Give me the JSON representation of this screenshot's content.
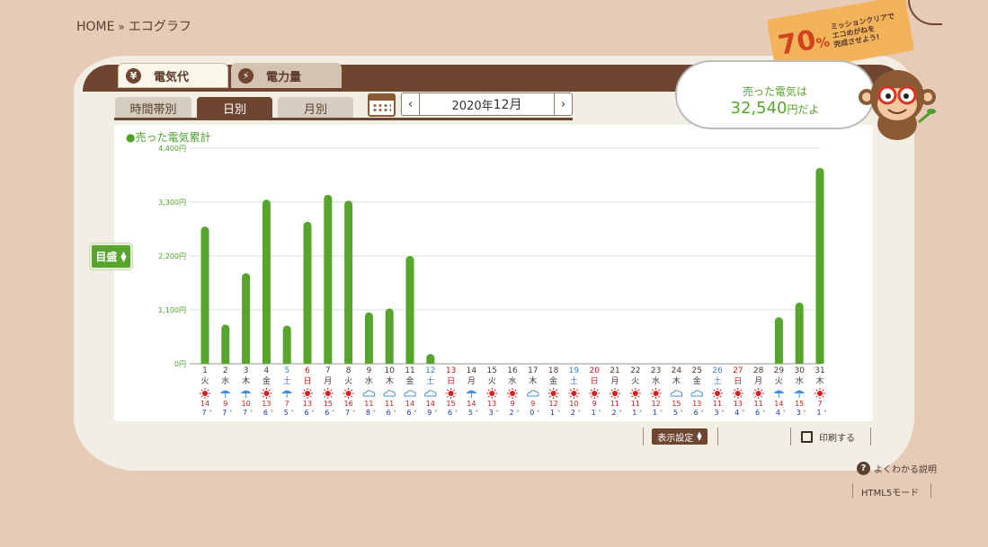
{
  "breadcrumb": {
    "home": "HOME",
    "sep": "»",
    "current": "エコグラフ"
  },
  "tabs": {
    "elec": "電気代",
    "elec_icon": "¥",
    "power": "電力量",
    "power_icon": "⚡"
  },
  "subtabs": {
    "time": "時間帯別",
    "day": "日別",
    "month": "月別"
  },
  "date": {
    "year": "2020年",
    "month": "12月",
    "prev": "‹",
    "next": "›"
  },
  "sold_label": "●売った電気累計",
  "scale_button": "目盛",
  "bubble": {
    "line1": "売った電気は",
    "amount": "32,540",
    "unit": "円だよ"
  },
  "mission": {
    "pct": "70",
    "pct_sign": "%",
    "line1": "ミッションクリアで",
    "line2": "エコめがねを",
    "line3": "完成させよう!"
  },
  "toolbar": {
    "display": "表示設定",
    "print": "印刷する"
  },
  "help": "よくわかる説明",
  "help_icon": "?",
  "html5": "HTML5モード",
  "colors": {
    "bar": "#57a52c",
    "wood": "#6e4530",
    "sat": "#3a7fd0",
    "sun": "#d01818"
  },
  "chart_data": {
    "type": "bar",
    "ylim": [
      0,
      4400
    ],
    "y_ticks": [
      "0円",
      "1,100円",
      "2,200円",
      "3,300円",
      "4,400円"
    ],
    "days": [
      "1",
      "2",
      "3",
      "4",
      "5",
      "6",
      "7",
      "8",
      "9",
      "10",
      "11",
      "12",
      "13",
      "14",
      "15",
      "16",
      "17",
      "18",
      "19",
      "20",
      "21",
      "22",
      "23",
      "24",
      "25",
      "26",
      "27",
      "28",
      "29",
      "30",
      "31"
    ],
    "weekdays": [
      "火",
      "水",
      "木",
      "金",
      "土",
      "日",
      "月",
      "火",
      "水",
      "木",
      "金",
      "土",
      "日",
      "月",
      "火",
      "水",
      "木",
      "金",
      "土",
      "日",
      "月",
      "火",
      "水",
      "木",
      "金",
      "土",
      "日",
      "月",
      "火",
      "水",
      "木"
    ],
    "values": [
      2800,
      800,
      1850,
      3350,
      780,
      2900,
      3450,
      3330,
      1050,
      1130,
      2200,
      200,
      0,
      0,
      0,
      0,
      0,
      0,
      0,
      0,
      0,
      0,
      0,
      0,
      0,
      0,
      0,
      0,
      950,
      1250,
      4000
    ],
    "weather": [
      "sun",
      "rain",
      "rain",
      "sun",
      "rain",
      "sun",
      "sun",
      "sun",
      "cloud",
      "cloud",
      "cloud",
      "cloud",
      "sun",
      "rain",
      "sun",
      "sun",
      "cloud",
      "sun",
      "sun",
      "sun",
      "sun",
      "sun",
      "sun",
      "cloud",
      "cloud",
      "sun",
      "sun",
      "sun",
      "rain",
      "rain",
      "sun"
    ],
    "temp_high": [
      "14",
      "9",
      "10",
      "13",
      "7",
      "13",
      "15",
      "16",
      "11",
      "11",
      "14",
      "14",
      "15",
      "14",
      "13",
      "9",
      "9",
      "12",
      "10",
      "9",
      "11",
      "11",
      "12",
      "15",
      "13",
      "11",
      "13",
      "11",
      "14",
      "15",
      "7"
    ],
    "temp_low": [
      "7",
      "7",
      "7",
      "6",
      "5",
      "6",
      "6",
      "7",
      "8",
      "6",
      "6",
      "9",
      "6",
      "5",
      "3",
      "2",
      "0",
      "1",
      "2",
      "1",
      "2",
      "1",
      "1",
      "5",
      "6",
      "3",
      "4",
      "6",
      "4",
      "3",
      "1"
    ]
  }
}
